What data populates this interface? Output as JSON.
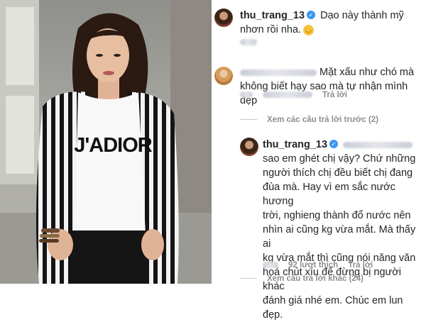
{
  "colors": {
    "verified": "#3897f0",
    "meta_text": "#8e8e8e",
    "primary_text": "#262626"
  },
  "photo": {
    "shirt_text": "J'ADIOR"
  },
  "post": {
    "username": "thu_trang_13",
    "caption": "Dạo này thành mỹ nhơn rồi nha.",
    "emoji": "😌"
  },
  "comment1": {
    "text_line1": "Mặt xấu như chó mà",
    "text_line2": "không biết hạy sao mà tự nhận mình đẹp",
    "reply_label": "Trả lời"
  },
  "view_previous": "Xem các câu trả lời trước (2)",
  "reply": {
    "username": "thu_trang_13",
    "lines": [
      "sao em ghét chị vậy? Chứ những",
      "người thích chị đều biết chị đang",
      "đùa mà. Hay vì em sắc nước hương",
      "trời, nghieng thành đổ nước nên",
      "nhìn ai cũng kg vừa mắt. Mà thấy ai",
      "kg vừa mắt thì cũng nói năng văn",
      "hoá chút xíu để đừng bị người khác",
      "đánh giá nhé em. Chúc em lun đẹp."
    ],
    "likes": "92 lượt thích",
    "reply_label": "Trả lời"
  },
  "view_more": "Xem câu trả lời khác (24)"
}
